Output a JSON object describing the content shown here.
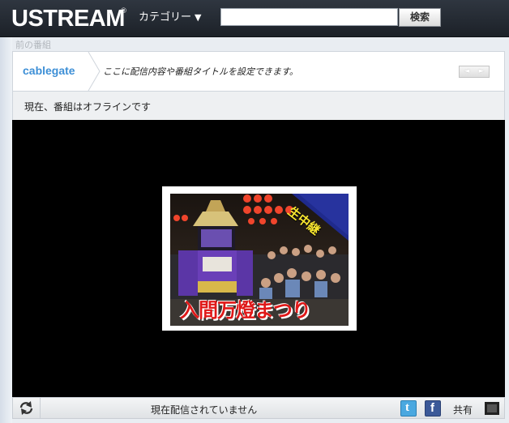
{
  "header": {
    "logo": "USTREAM",
    "logo_mark": "®",
    "category_label": "カテゴリー",
    "category_caret": "▼",
    "search_placeholder": "",
    "search_button": "検索"
  },
  "breadcrumb": {
    "prev_program": "前の番組"
  },
  "channel": {
    "name": "cablegate",
    "title": "ここに配信内容や番組タイトルを設定できます。",
    "nav_prev": "◄",
    "nav_next": "►"
  },
  "status": {
    "text": "現在、番組はオフラインです"
  },
  "thumbnail": {
    "banner": "生中継",
    "caption": "入間万燈まつり"
  },
  "controls": {
    "offline_text": "現在配信されていません",
    "share_label": "共有",
    "twitter_glyph": "t",
    "facebook_glyph": "f"
  },
  "colors": {
    "topbar": "#1c2128",
    "channel_name": "#3d8fd6",
    "twitter": "#4aa8e0",
    "facebook": "#3b5998",
    "banner": "#1f2a8c",
    "caption": "#d81818"
  }
}
